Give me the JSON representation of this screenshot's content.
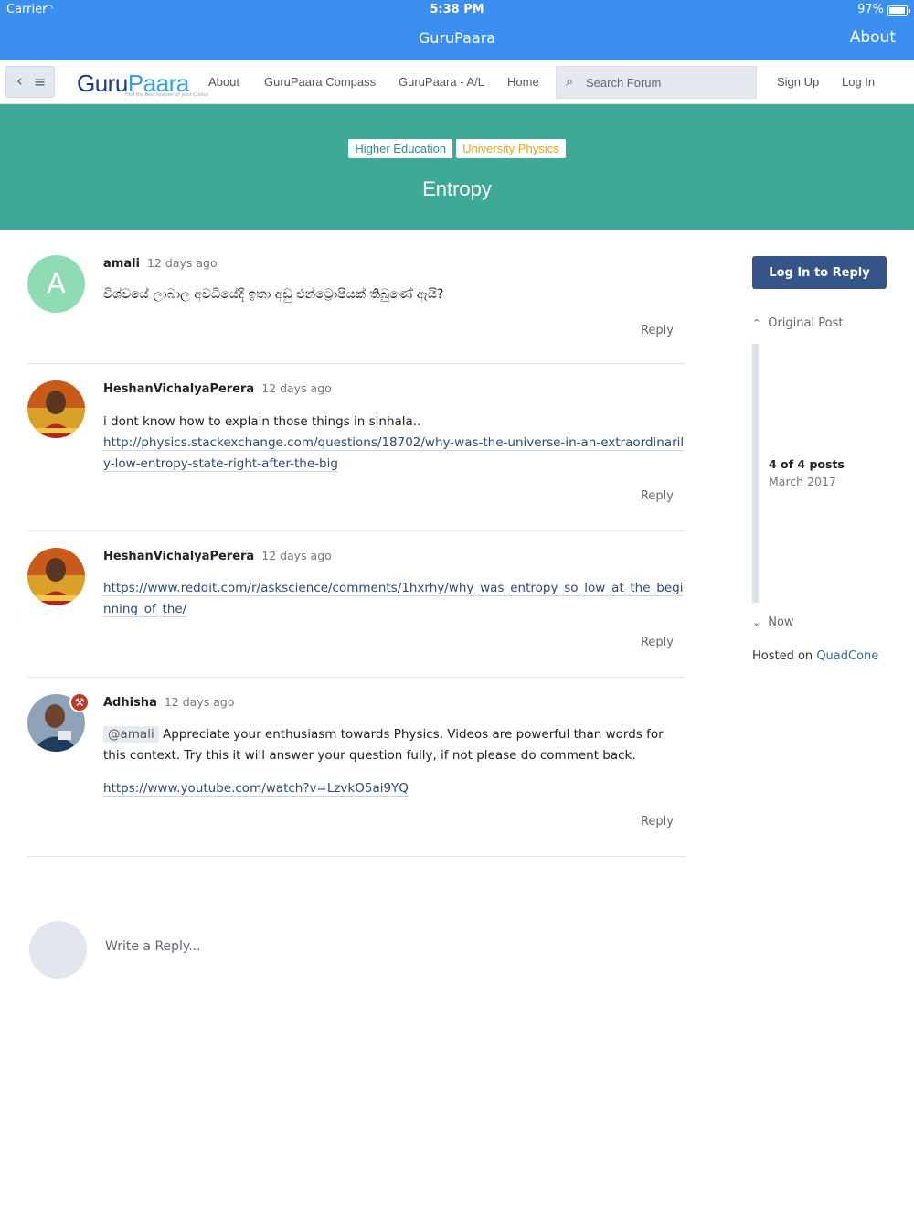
{
  "status_bar": {
    "carrier": "Carrier",
    "time": "5:38 PM",
    "battery": "97%"
  },
  "app_nav": {
    "title": "GuruPaara",
    "about": "About"
  },
  "header": {
    "logo_guru": "Guru",
    "logo_paara": "Paara",
    "logo_tagline": "Find the Best teacher of your Choice",
    "links": [
      "About",
      "GuruPaara Compass",
      "GuruPaara - A/L",
      "Home"
    ],
    "search_placeholder": "Search Forum",
    "sign_up": "Sign Up",
    "log_in": "Log In"
  },
  "topic": {
    "tags": [
      "Higher Education",
      "University Physics"
    ],
    "title": "Entropy"
  },
  "posts": [
    {
      "author": "amali",
      "time": "12 days ago",
      "avatar_letter": "A",
      "text": "විශ්වයේ ලාබාල අවධියේදී ඉතා අඩු එන්ට්‍රොපියක් තිබුණේ ඇයි?",
      "reply": "Reply"
    },
    {
      "author": "HeshanVichalyaPerera",
      "time": "12 days ago",
      "text": "i dont know how to explain those things in sinhala..",
      "link": "http://physics.stackexchange.com/questions/18702/why-was-the-universe-in-an-extraordinarily-low-entropy-state-right-after-the-big",
      "reply": "Reply"
    },
    {
      "author": "HeshanVichalyaPerera",
      "time": "12 days ago",
      "link": "https://www.reddit.com/r/askscience/comments/1hxrhy/why_was_entropy_so_low_at_the_beginning_of_the/",
      "reply": "Reply"
    },
    {
      "author": "Adhisha",
      "time": "12 days ago",
      "mention": "@amali",
      "text": "Appreciate your enthusiasm towards Physics. Videos are powerful than words for this context. Try this it will answer your question fully, if not please do comment back.",
      "link": "https://www.youtube.com/watch?v=LzvkO5ai9YQ",
      "reply": "Reply"
    }
  ],
  "sidebar": {
    "login_reply": "Log In to Reply",
    "original_post": "Original Post",
    "posts_count": "4 of 4 posts",
    "date": "March 2017",
    "now": "Now",
    "hosted_prefix": "Hosted on",
    "hosted_link": "QuadCone"
  },
  "composer": {
    "placeholder": "Write a Reply..."
  }
}
